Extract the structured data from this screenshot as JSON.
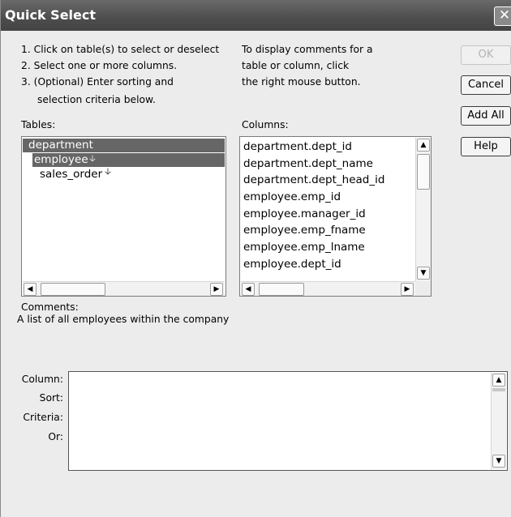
{
  "window": {
    "title": "Quick Select",
    "close_glyph": "✕"
  },
  "instructions": {
    "step1": "1. Click on table(s) to select or deselect",
    "step2": "2. Select one or more columns.",
    "step3": "3. (Optional) Enter sorting and",
    "step3b": "selection criteria below."
  },
  "comments_hint": {
    "line1": "To display comments for a",
    "line2": "table or column, click",
    "line3": "the right mouse button."
  },
  "buttons": {
    "ok": "OK",
    "cancel": "Cancel",
    "add_all": "Add All",
    "help": "Help"
  },
  "tables": {
    "label": "Tables:",
    "items": [
      "department",
      "employee",
      "sales_order"
    ],
    "selected": [
      "department",
      "employee"
    ]
  },
  "columns": {
    "label": "Columns:",
    "items": [
      "department.dept_id",
      "department.dept_name",
      "department.dept_head_id",
      "employee.emp_id",
      "employee.manager_id",
      "employee.emp_fname",
      "employee.emp_lname",
      "employee.dept_id"
    ]
  },
  "comments": {
    "label": "Comments:",
    "text": "A list of all employees within the company"
  },
  "criteria": {
    "row_labels": [
      "Column:",
      "Sort:",
      "Criteria:",
      "Or:"
    ]
  },
  "icons": {
    "close": "close-icon",
    "scroll_up": "chevron-up-icon",
    "scroll_down": "chevron-down-icon",
    "scroll_left": "chevron-left-icon",
    "scroll_right": "chevron-right-icon"
  }
}
